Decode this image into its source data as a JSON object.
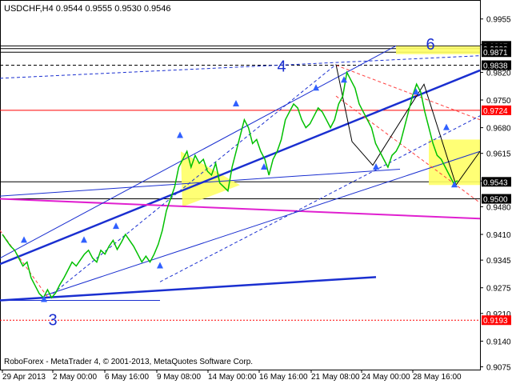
{
  "chart_data": {
    "type": "line",
    "title": "USDCHF,H4  0.9544 0.9555 0.9530 0.9546",
    "footer": "RoboForex - MetaTrader 4, © 2001-2013, MetaQuotes Software Corp.",
    "x_ticks": [
      "29 Apr 2013",
      "2 May 00:00",
      "6 May 16:00",
      "9 May 08:00",
      "14 May 00:00",
      "16 May 16:00",
      "21 May 08:00",
      "24 May 00:00",
      "28 May 16:00"
    ],
    "y_ticks": [
      0.9955,
      0.989,
      0.982,
      0.975,
      0.968,
      0.9615,
      0.9545,
      0.948,
      0.941,
      0.9345,
      0.9275,
      0.921,
      0.914,
      0.9075
    ],
    "ylim": [
      0.9068,
      1.0003
    ],
    "price_labels": [
      {
        "value": 0.9887,
        "text": "0.9887",
        "bg": "#000000"
      },
      {
        "value": 0.988,
        "text": "0.9880",
        "bg": "#000000"
      },
      {
        "value": 0.9871,
        "text": "0.9871",
        "bg": "#000000"
      },
      {
        "value": 0.9838,
        "text": "0.9838",
        "bg": "#000000"
      },
      {
        "value": 0.9724,
        "text": "0.9724",
        "bg": "#ff0000"
      },
      {
        "value": 0.9543,
        "text": "0.9543",
        "bg": "#000000"
      },
      {
        "value": 0.95,
        "text": "0.9500",
        "bg": "#000000"
      },
      {
        "value": 0.9193,
        "text": "0.9193",
        "bg": "#ff0000"
      }
    ],
    "horizontal_levels": [
      {
        "value": 0.9887,
        "color": "#000000",
        "style": "solid"
      },
      {
        "value": 0.988,
        "color": "#000000",
        "style": "solid"
      },
      {
        "value": 0.9871,
        "color": "#000000",
        "style": "solid"
      },
      {
        "value": 0.9838,
        "color": "#000000",
        "style": "dashed"
      },
      {
        "value": 0.9724,
        "color": "#ff0000",
        "style": "solid"
      },
      {
        "value": 0.9543,
        "color": "#000000",
        "style": "solid"
      },
      {
        "value": 0.95,
        "color": "#000000",
        "style": "solid"
      },
      {
        "value": 0.9193,
        "color": "#ff0000",
        "style": "dotted"
      }
    ],
    "wave_labels": [
      {
        "text": "3",
        "x": 66,
        "y": 0.918,
        "color": "#1a2fd0"
      },
      {
        "text": "4",
        "x": 352,
        "y": 0.9822,
        "color": "#1a2fd0"
      },
      {
        "text": "6",
        "x": 538,
        "y": 0.9878,
        "color": "#1a2fd0"
      }
    ],
    "closes": [
      0.941,
      0.9395,
      0.938,
      0.937,
      0.935,
      0.933,
      0.934,
      0.93,
      0.928,
      0.926,
      0.925,
      0.927,
      0.925,
      0.9262,
      0.9283,
      0.93,
      0.932,
      0.934,
      0.933,
      0.9345,
      0.936,
      0.937,
      0.935,
      0.934,
      0.937,
      0.936,
      0.938,
      0.9395,
      0.9372,
      0.939,
      0.941,
      0.9395,
      0.938,
      0.936,
      0.934,
      0.9355,
      0.934,
      0.936,
      0.9385,
      0.942,
      0.947,
      0.95,
      0.953,
      0.958,
      0.96,
      0.962,
      0.958,
      0.961,
      0.959,
      0.96,
      0.957,
      0.956,
      0.959,
      0.954,
      0.953,
      0.952,
      0.958,
      0.962,
      0.966,
      0.97,
      0.968,
      0.964,
      0.965,
      0.962,
      0.96,
      0.956,
      0.96,
      0.962,
      0.965,
      0.97,
      0.972,
      0.974,
      0.973,
      0.97,
      0.968,
      0.969,
      0.971,
      0.973,
      0.972,
      0.97,
      0.968,
      0.97,
      0.974,
      0.976,
      0.982,
      0.98,
      0.978,
      0.974,
      0.972,
      0.97,
      0.968,
      0.964,
      0.962,
      0.96,
      0.958,
      0.961,
      0.962,
      0.964,
      0.968,
      0.972,
      0.976,
      0.979,
      0.977,
      0.972,
      0.968,
      0.964,
      0.961,
      0.96,
      0.958,
      0.956,
      0.954,
      0.9546
    ]
  }
}
